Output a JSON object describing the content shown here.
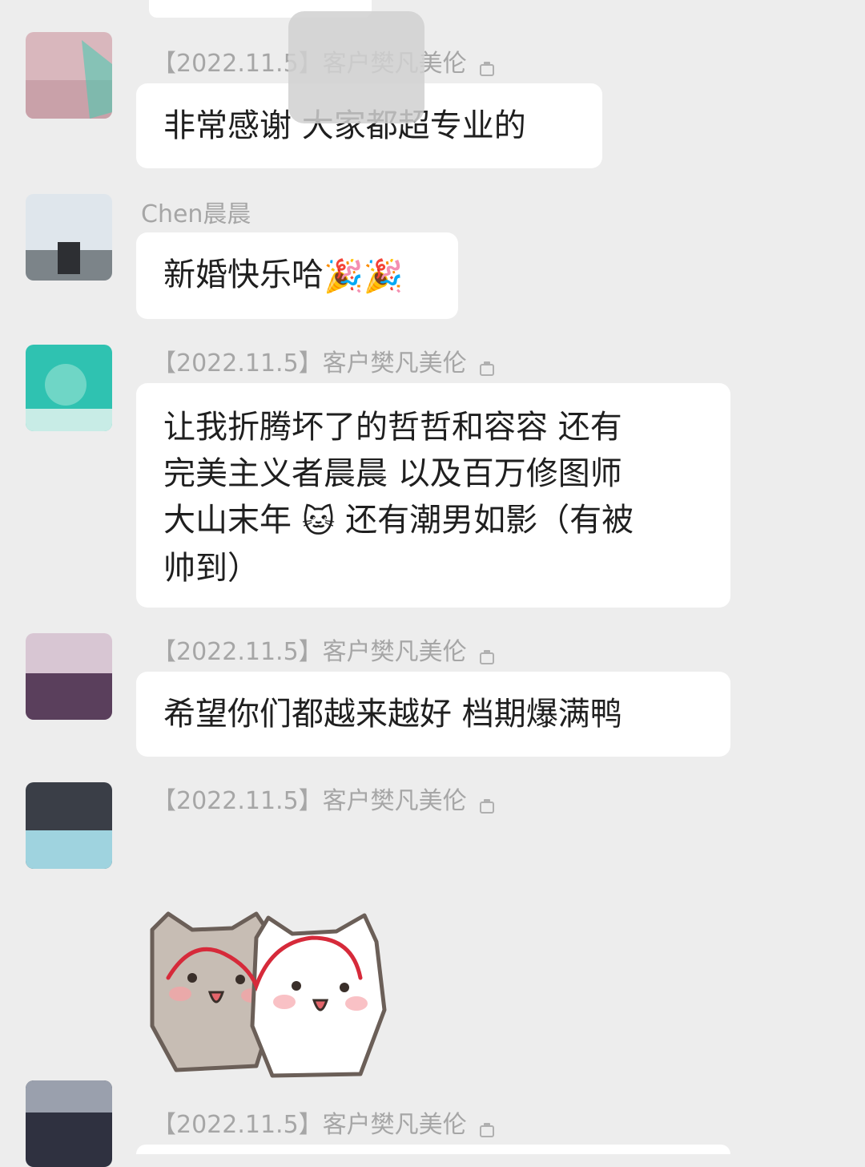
{
  "messages": [
    {
      "sender": "【2022.11.5】客户樊凡美伦",
      "text": "非常感谢 大家都超专业的"
    },
    {
      "sender": "Chen晨晨",
      "text": "新婚快乐哈",
      "emojis": [
        "🎉",
        "🎉"
      ]
    },
    {
      "sender": "【2022.11.5】客户樊凡美伦",
      "text_line1": "让我折腾坏了的哲哲和容容 还有",
      "text_line2": "完美主义者晨晨 以及百万修图师",
      "text_line3_a": "大山末年",
      "emoji": "🐱",
      "text_line3_b": "还有潮男如影（有被",
      "text_line4": "帅到）"
    },
    {
      "sender": "【2022.11.5】客户樊凡美伦",
      "text": "希望你们都越来越好 档期爆满鸭"
    },
    {
      "sender": "【2022.11.5】客户樊凡美伦",
      "sticker": "two-cats-sticker"
    },
    {
      "sender": "【2022.11.5】客户樊凡美伦"
    }
  ],
  "colors": {
    "background": "#ededed",
    "bubble": "#ffffff",
    "sender_text": "#a6a6a6",
    "message_text": "#1f1f1f"
  }
}
